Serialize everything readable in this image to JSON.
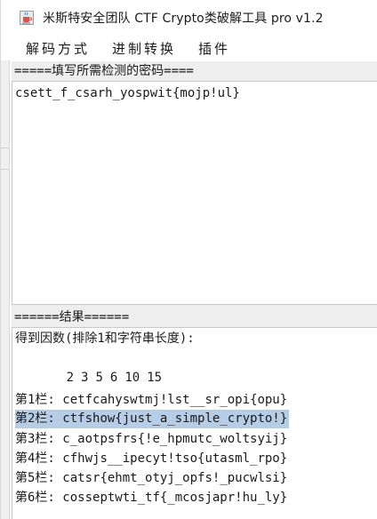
{
  "window": {
    "title": "米斯特安全团队 CTF Crypto类破解工具 pro v1.2",
    "icon": "java-cup-icon"
  },
  "menu": {
    "items": [
      {
        "label": "解码方式"
      },
      {
        "label": "进制转换"
      },
      {
        "label": "插件"
      }
    ]
  },
  "input": {
    "header": "=====填写所需检测的密码====",
    "value": "csett_f_csarh_yospwit{mojp!ul}"
  },
  "results": {
    "header": "======结果======",
    "factors_label": "得到因数(排除1和字符串长度):",
    "factors": [
      "2",
      "3",
      "5",
      "6",
      "10",
      "15"
    ],
    "rows": [
      {
        "label": "第1栏:",
        "text": "cetfcahyswtmj!lst__sr_opi{opu}"
      },
      {
        "label": "第2栏:",
        "text": "ctfshow{just_a_simple_crypto!}",
        "selected": true
      },
      {
        "label": "第3栏:",
        "text": "c_aotpsfrs{!e_hpmutc_woltsyij}"
      },
      {
        "label": "第4栏:",
        "text": "cfhwjs__ipecyt!tso{utasml_rpo}"
      },
      {
        "label": "第5栏:",
        "text": "catsr{ehmt_otyj_opfs!_pucwlsi}"
      },
      {
        "label": "第6栏:",
        "text": "cosseptwti_tf{_mcosjapr!hu_ly}"
      }
    ]
  },
  "colors": {
    "selection": "#b5cde6",
    "header_bg": "#eeeeee"
  }
}
